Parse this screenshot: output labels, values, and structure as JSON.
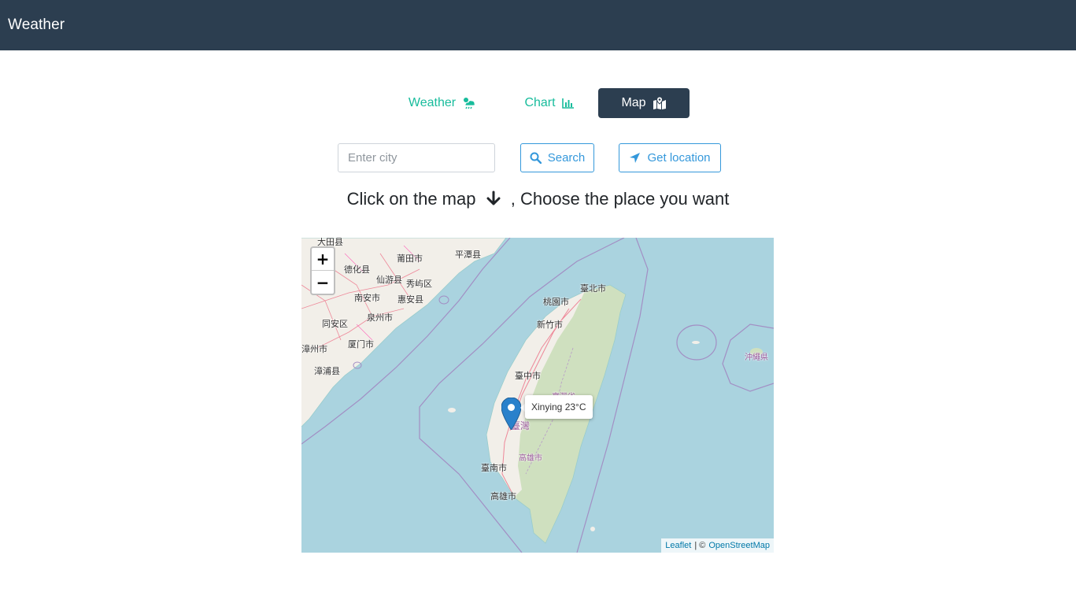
{
  "app": {
    "title": "Weather"
  },
  "tabs": [
    {
      "label": "Weather",
      "icon": "cloud-sun-rain-icon",
      "active": false
    },
    {
      "label": "Chart",
      "icon": "chart-bar-icon",
      "active": false
    },
    {
      "label": "Map",
      "icon": "map-marked-icon",
      "active": true
    }
  ],
  "search": {
    "placeholder": "Enter city",
    "value": "",
    "search_label": "Search",
    "location_label": "Get location"
  },
  "heading": {
    "before": "Click on the map",
    "after": ", Choose the place you want"
  },
  "map": {
    "zoom_in": "+",
    "zoom_out": "−",
    "popup": "Xinying 23°C",
    "attribution": {
      "leaflet": "Leaflet",
      "sep": "| ©",
      "osm": "OpenStreetMap"
    },
    "labels": [
      "莆田市",
      "平潭县",
      "德化县",
      "仙游县",
      "秀屿区",
      "南安市",
      "惠安县",
      "泉州市",
      "同安区",
      "厦门市",
      "漳州市",
      "漳浦县",
      "臺北市",
      "桃園市",
      "新竹市",
      "臺中市",
      "臺灣省",
      "臺灣",
      "高雄市",
      "臺南市",
      "高雄市",
      "沖繩県",
      "大田县"
    ]
  },
  "colors": {
    "navbar": "#2c3e50",
    "tab_text": "#18bc9c",
    "button_accent": "#3498db",
    "sea": "#aad3df",
    "land": "#f2efe9",
    "marker": "#2a81cb"
  }
}
